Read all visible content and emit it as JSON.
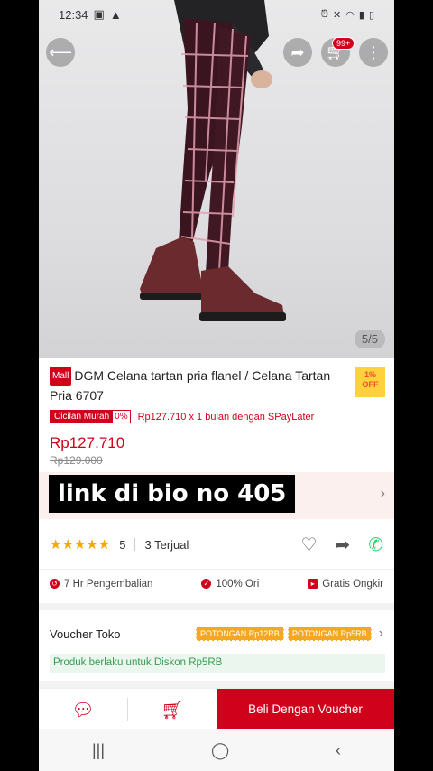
{
  "status": {
    "time": "12:34",
    "left_icons": [
      "image-icon",
      "warning-icon"
    ],
    "right_icons": [
      "alarm-icon",
      "mute-icon",
      "wifi-icon",
      "signal-icon",
      "battery-icon"
    ]
  },
  "top": {
    "cart_badge": "99+",
    "image_indicator": "5/5"
  },
  "product": {
    "mall_badge": "Mall",
    "title": "DGM Celana tartan pria flanel / Celana Tartan Pria 6707",
    "discount_flag_line1": "1%",
    "discount_flag_line2": "OFF",
    "cicilan_label": "Cicilan Murah",
    "cicilan_rate": "0%",
    "cicilan_text": "Rp127.710 x 1 bulan dengan SPayLater",
    "price": "Rp127.710",
    "old_price": "Rp129.000"
  },
  "overlay": {
    "text": "link di bio no 405"
  },
  "rating": {
    "stars": "★★★★★",
    "value": "5",
    "sold": "3 Terjual"
  },
  "benefits": [
    {
      "label": "7 Hr Pengembalian",
      "icon": "return-icon"
    },
    {
      "label": "100% Ori",
      "icon": "shield-icon"
    },
    {
      "label": "Gratis Ongkir",
      "icon": "truck-icon"
    }
  ],
  "voucher": {
    "label": "Voucher Toko",
    "tags": [
      "POTONGAN Rp12RB",
      "POTONGAN Rp5RB"
    ],
    "discount_note": "Produk berlaku untuk Diskon Rp5RB"
  },
  "bottom": {
    "buy_label": "Beli Dengan Voucher"
  },
  "colors": {
    "brand": "#d0021b",
    "star": "#f6a700",
    "voucher_tag": "#f5a623"
  }
}
